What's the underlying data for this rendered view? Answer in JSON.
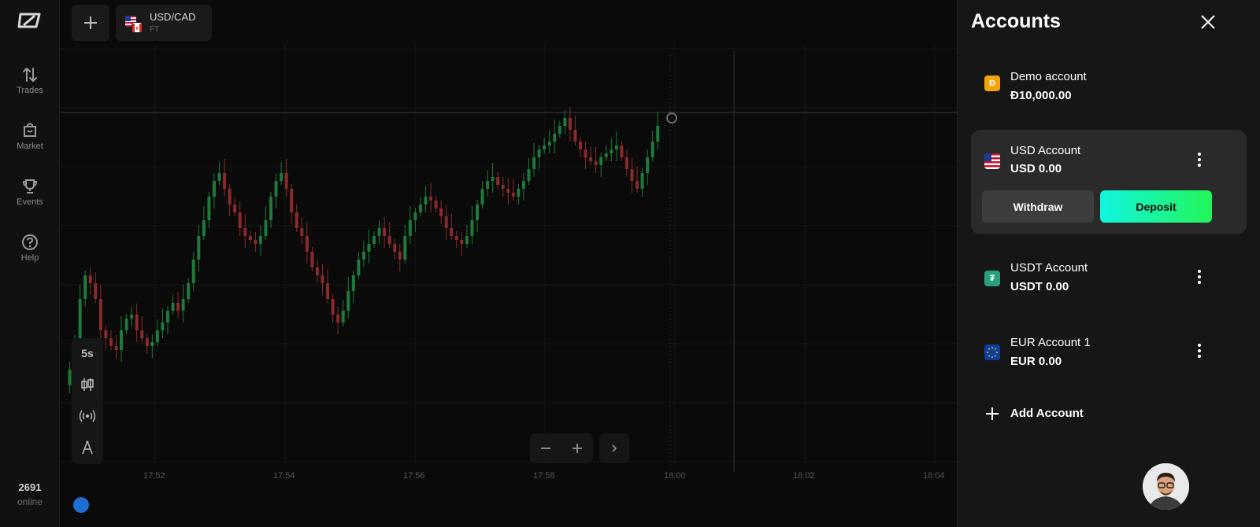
{
  "nav": {
    "items": [
      {
        "label": "Trades",
        "icon": "trades-icon"
      },
      {
        "label": "Market",
        "icon": "market-icon"
      },
      {
        "label": "Events",
        "icon": "trophy-icon"
      },
      {
        "label": "Help",
        "icon": "help-icon"
      }
    ],
    "online_count": "2691",
    "online_label": "online"
  },
  "topbar": {
    "asset_name": "USD/CAD",
    "asset_type": "FT"
  },
  "chart": {
    "timeframe": "5s",
    "time_labels": [
      "17:52",
      "17:54",
      "17:56",
      "17:58",
      "18:00",
      "18:02",
      "18:04"
    ]
  },
  "accounts": {
    "title": "Accounts",
    "list": [
      {
        "name": "Demo account",
        "balance": "Đ10,000.00",
        "icon_letter": "Đ",
        "icon_color": "#f5a30b"
      },
      {
        "name": "USD Account",
        "balance": "USD 0.00",
        "selected": true
      },
      {
        "name": "USDT Account",
        "balance": "USDT 0.00",
        "icon_letter": "₮",
        "icon_color": "#26a17b"
      },
      {
        "name": "EUR Account 1",
        "balance": "EUR 0.00",
        "icon_color": "#0d3d9c"
      }
    ],
    "withdraw_label": "Withdraw",
    "deposit_label": "Deposit",
    "add_label": "Add Account",
    "colors": {
      "deposit_start": "#10f5e0",
      "deposit_end": "#22f558",
      "bull": "#1f7a3a",
      "bear": "#8a2a2a"
    }
  }
}
